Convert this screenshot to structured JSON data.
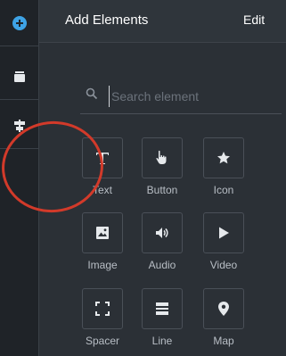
{
  "panel": {
    "title": "Add Elements",
    "edit_label": "Edit"
  },
  "sidebar": {
    "items": [
      {
        "name": "add",
        "icon": "plus-circle-icon",
        "color": "#3ea3e6"
      },
      {
        "name": "layers",
        "icon": "layers-icon"
      },
      {
        "name": "alignment",
        "icon": "alignment-icon"
      }
    ]
  },
  "search": {
    "placeholder": "Search element",
    "value": ""
  },
  "elements": [
    {
      "label": "Text",
      "icon": "text-icon"
    },
    {
      "label": "Button",
      "icon": "pointer-hand-icon"
    },
    {
      "label": "Icon",
      "icon": "star-icon"
    },
    {
      "label": "Image",
      "icon": "image-icon"
    },
    {
      "label": "Audio",
      "icon": "speaker-icon"
    },
    {
      "label": "Video",
      "icon": "play-icon"
    },
    {
      "label": "Spacer",
      "icon": "spacer-icon"
    },
    {
      "label": "Line",
      "icon": "line-icon"
    },
    {
      "label": "Map",
      "icon": "map-pin-icon"
    }
  ],
  "annotation": {
    "color": "#d23a2a"
  }
}
